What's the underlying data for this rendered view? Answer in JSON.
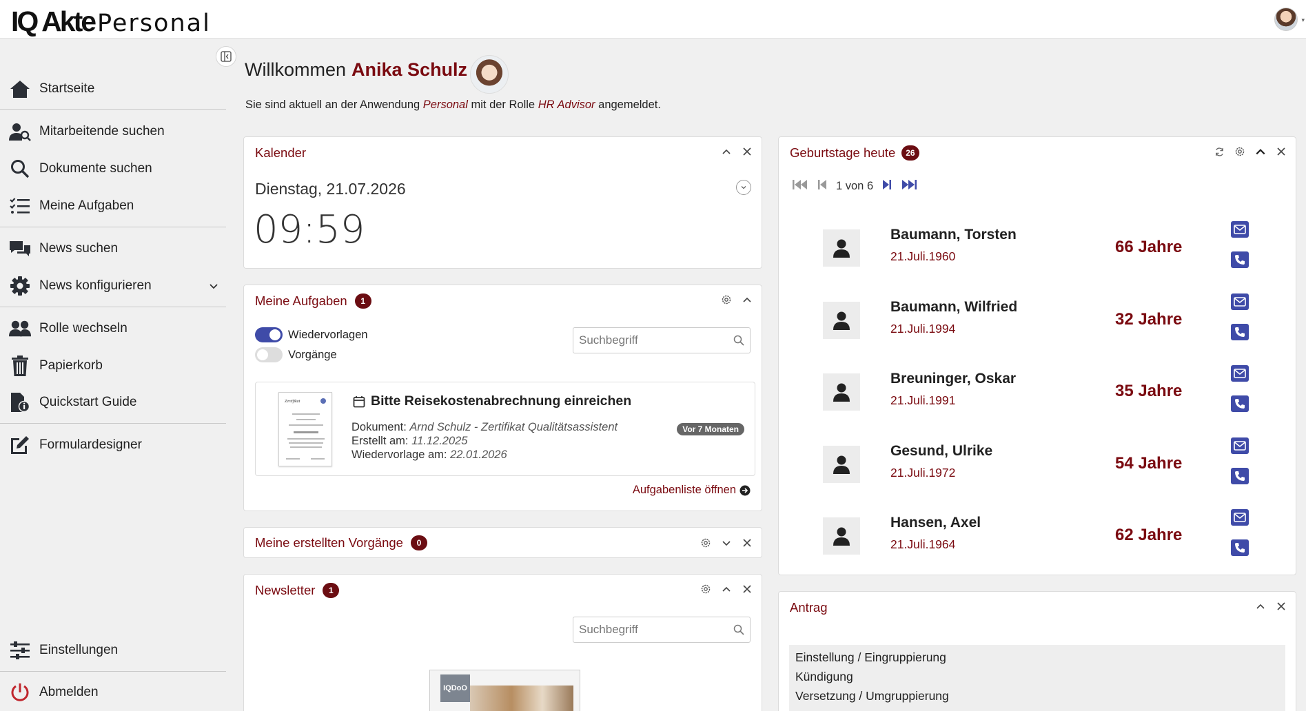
{
  "app": {
    "logo_mark": "IQ Akte",
    "logo_sub": "Personal"
  },
  "sidebar": {
    "items": [
      {
        "label": "Startseite",
        "icon": "home-icon"
      },
      {
        "label": "Mitarbeitende suchen",
        "icon": "user-search-icon"
      },
      {
        "label": "Dokumente suchen",
        "icon": "search-icon"
      },
      {
        "label": "Meine Aufgaben",
        "icon": "checklist-icon"
      },
      {
        "label": "News suchen",
        "icon": "chat-icon"
      },
      {
        "label": "News konfigurieren",
        "icon": "gear-icon"
      },
      {
        "label": "Rolle wechseln",
        "icon": "users-icon"
      },
      {
        "label": "Papierkorb",
        "icon": "trash-icon"
      },
      {
        "label": "Quickstart Guide",
        "icon": "document-info-icon"
      },
      {
        "label": "Formulardesigner",
        "icon": "edit-icon"
      },
      {
        "label": "Einstellungen",
        "icon": "sliders-icon"
      },
      {
        "label": "Abmelden",
        "icon": "power-icon"
      }
    ]
  },
  "welcome": {
    "greeting": "Willkommen",
    "name": "Anika Schulz",
    "sub_pre": "Sie sind aktuell an der Anwendung",
    "app_name": "Personal",
    "sub_mid": "mit der Rolle",
    "role": "HR Advisor",
    "sub_post": "angemeldet."
  },
  "calendar": {
    "title": "Kalender",
    "date": "Dienstag, 21.07.2026",
    "time": "09:59"
  },
  "tasks": {
    "title": "Meine Aufgaben",
    "count": "1",
    "toggle_1": "Wiedervorlagen",
    "toggle_1_on": true,
    "toggle_2": "Vorgänge",
    "toggle_2_on": false,
    "search_placeholder": "Suchbegriff",
    "item": {
      "title": "Bitte Reisekostenabrechnung einreichen",
      "doc_label": "Dokument:",
      "doc_value": "Arnd Schulz - Zertifikat Qualitätsassistent",
      "created_label": "Erstellt am:",
      "created_value": "11.12.2025",
      "resub_label": "Wiedervorlage am:",
      "resub_value": "22.01.2026",
      "age": "Vor 7 Monaten",
      "thumb_heading": "Zertifikat"
    },
    "link": "Aufgabenliste öffnen"
  },
  "created": {
    "title": "Meine erstellten Vorgänge",
    "count": "0"
  },
  "newsletter": {
    "title": "Newsletter",
    "count": "1",
    "search_placeholder": "Suchbegriff",
    "image_logo": "IQDoO"
  },
  "birthdays": {
    "title": "Geburtstage heute",
    "count": "26",
    "page": "1 von 6",
    "people": [
      {
        "name": "Baumann, Torsten",
        "date": "21.Juli.1960",
        "age": "66 Jahre"
      },
      {
        "name": "Baumann, Wilfried",
        "date": "21.Juli.1994",
        "age": "32 Jahre"
      },
      {
        "name": "Breuninger, Oskar",
        "date": "21.Juli.1991",
        "age": "35 Jahre"
      },
      {
        "name": "Gesund, Ulrike",
        "date": "21.Juli.1972",
        "age": "54 Jahre"
      },
      {
        "name": "Hansen, Axel",
        "date": "21.Juli.1964",
        "age": "62 Jahre"
      }
    ]
  },
  "antrag": {
    "title": "Antrag",
    "items": [
      "Einstellung / Eingruppierung",
      "Kündigung",
      "Versetzung / Umgruppierung"
    ]
  },
  "colors": {
    "accent": "#7a0a10",
    "primary": "#3f4ba8",
    "background": "#f0f0f0"
  }
}
